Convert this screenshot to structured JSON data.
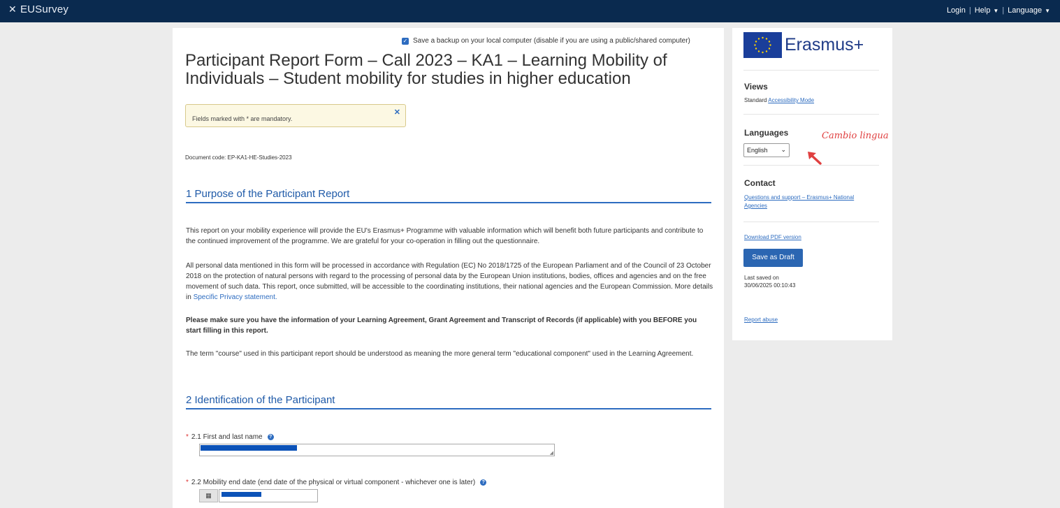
{
  "header": {
    "brand": "EUSurvey",
    "nav": {
      "login": "Login",
      "help": "Help",
      "language": "Language"
    }
  },
  "main": {
    "backup_label": "Save a backup on your local computer (disable if you are using a public/shared computer)",
    "title": "Participant Report Form – Call 2023 – KA1 – Learning Mobility of Individuals – Student mobility for studies in higher education",
    "notice": "Fields marked with * are mandatory.",
    "doc_code": "Document code: EP-KA1-HE-Studies-2023",
    "sections": [
      {
        "title": "1 Purpose of the Participant Report"
      },
      {
        "title": "2 Identification of the Participant"
      }
    ],
    "paragraphs": {
      "p1": "This report on your mobility experience will provide the EU's Erasmus+ Programme with valuable information which will benefit both future participants and contribute to the continued improvement of the programme. We are grateful for your co-operation in filling out the questionnaire.",
      "p2": "All personal data mentioned in this form will be processed in accordance with Regulation (EC) No 2018/1725 of the European Parliament and of the Council of 23 October 2018 on the protection of natural persons with regard to the processing of personal data by the European Union institutions, bodies, offices and agencies and on the free movement of such data. This report, once submitted, will be accessible to the coordinating institutions, their national agencies and the European Commission. More details in",
      "p2_link": "Specific Privacy statement.",
      "p3": "Please make sure you have the information of your Learning Agreement, Grant Agreement and Transcript of Records (if applicable) with you BEFORE you start filling in this report.",
      "p4": "The term \"course\" used in this participant report should be understood as meaning the more general term \"educational component\" used in the Learning Agreement."
    },
    "questions": [
      {
        "label": "2.1 First and last name"
      },
      {
        "label": "2.2 Mobility end date (end date of the physical or virtual component - whichever one is later)"
      }
    ]
  },
  "sidebar": {
    "logo_text": "Erasmus+",
    "views": {
      "heading": "Views",
      "standard": "Standard",
      "accessibility": "Accessibility Mode"
    },
    "languages": {
      "heading": "Languages",
      "selected": "English",
      "annotation": "Cambio lingua"
    },
    "contact": {
      "heading": "Contact",
      "link": "Questions and support – Erasmus+ National Agencies"
    },
    "download_pdf": "Download PDF version",
    "save_draft": "Save as Draft",
    "last_saved_label": "Last saved on",
    "last_saved_value": "30/06/2025 00:10:43",
    "report_abuse": "Report abuse"
  },
  "colors": {
    "topbar": "#0a2a4f",
    "accent": "#2d6cc0",
    "annotation": "#e04040"
  }
}
